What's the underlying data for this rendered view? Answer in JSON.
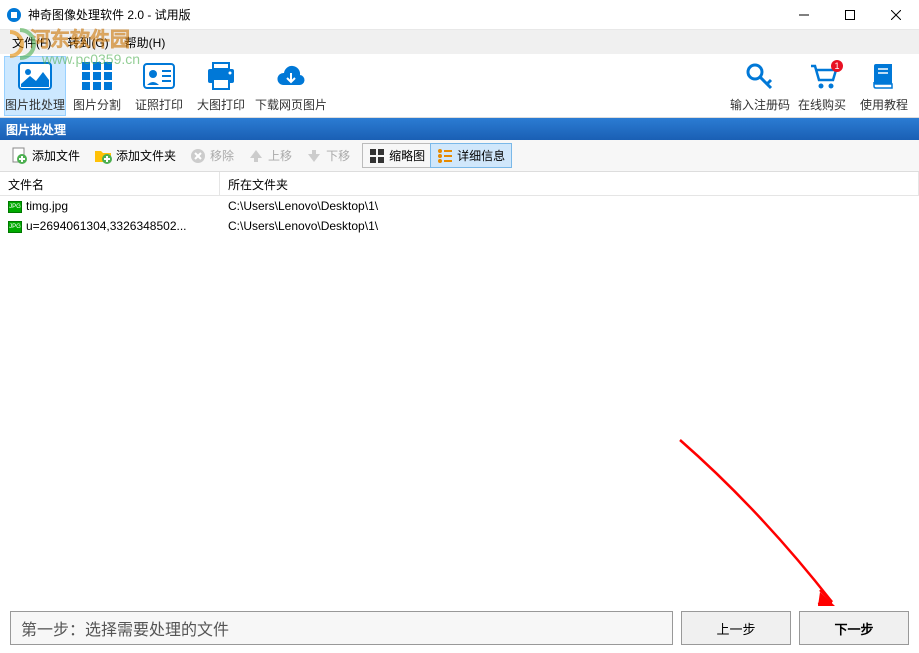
{
  "window": {
    "title": "神奇图像处理软件 2.0 - 试用版"
  },
  "menubar": {
    "file": "文件(F)",
    "goto": "转到(G)",
    "help": "帮助(H)"
  },
  "toolbar": {
    "batch": "图片批处理",
    "split": "图片分割",
    "idprint": "证照打印",
    "bigprint": "大图打印",
    "download": "下载网页图片",
    "regcode": "输入注册码",
    "buy": "在线购买",
    "tutorial": "使用教程",
    "badge_count": "1"
  },
  "section": {
    "title": "图片批处理"
  },
  "subtoolbar": {
    "add_file": "添加文件",
    "add_folder": "添加文件夹",
    "remove": "移除",
    "move_up": "上移",
    "move_down": "下移",
    "thumbnail": "缩略图",
    "details": "详细信息"
  },
  "columns": {
    "filename": "文件名",
    "folder": "所在文件夹"
  },
  "files": [
    {
      "name": "timg.jpg",
      "folder": "C:\\Users\\Lenovo\\Desktop\\1\\"
    },
    {
      "name": "u=2694061304,3326348502...",
      "folder": "C:\\Users\\Lenovo\\Desktop\\1\\"
    }
  ],
  "footer": {
    "step_text": "第一步：选择需要处理的文件",
    "prev": "上一步",
    "next": "下一步"
  },
  "watermark": {
    "line1": "河东软件园",
    "url": "www.pc0359.cn"
  }
}
